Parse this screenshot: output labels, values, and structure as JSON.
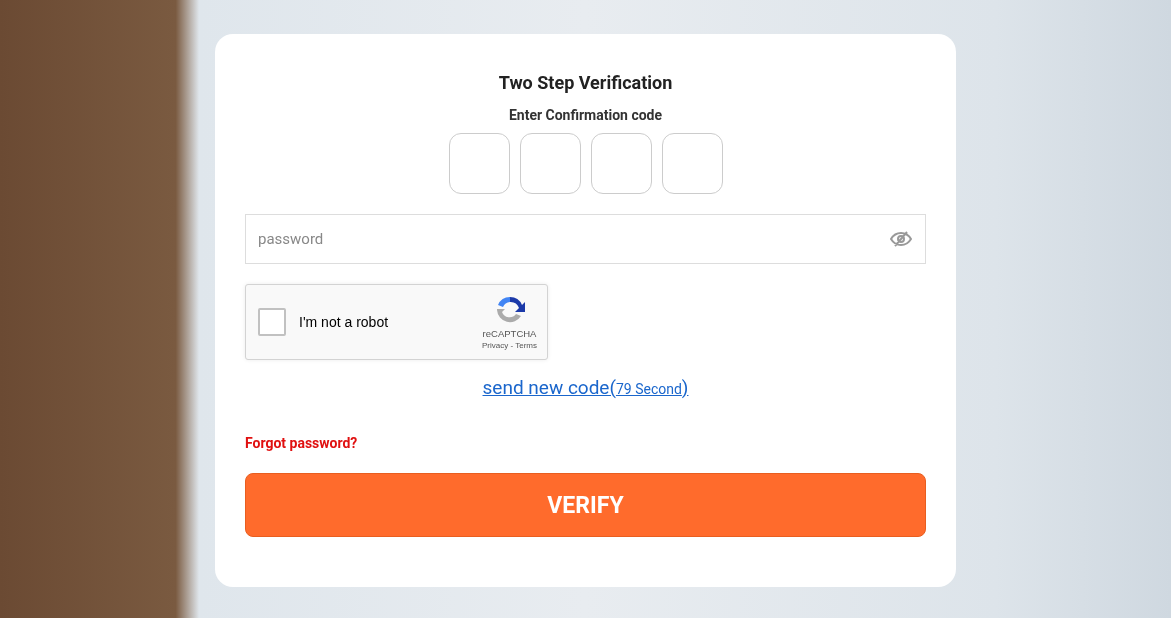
{
  "title": "Two Step Verification",
  "subtitle": "Enter Confirmation code",
  "code_boxes": [
    {
      "focused": false
    },
    {
      "focused": false
    },
    {
      "focused": false
    },
    {
      "focused": false
    }
  ],
  "password": {
    "placeholder": "password"
  },
  "captcha": {
    "label": "I'm not a robot",
    "checked": false,
    "brand": "reCAPTCHA",
    "links": "Privacy - Terms"
  },
  "resend": {
    "text": "send new code(",
    "countdown": "79 Second",
    "close": ")"
  },
  "forgot_link": "Forgot password?",
  "verify_button": "VERIFY"
}
